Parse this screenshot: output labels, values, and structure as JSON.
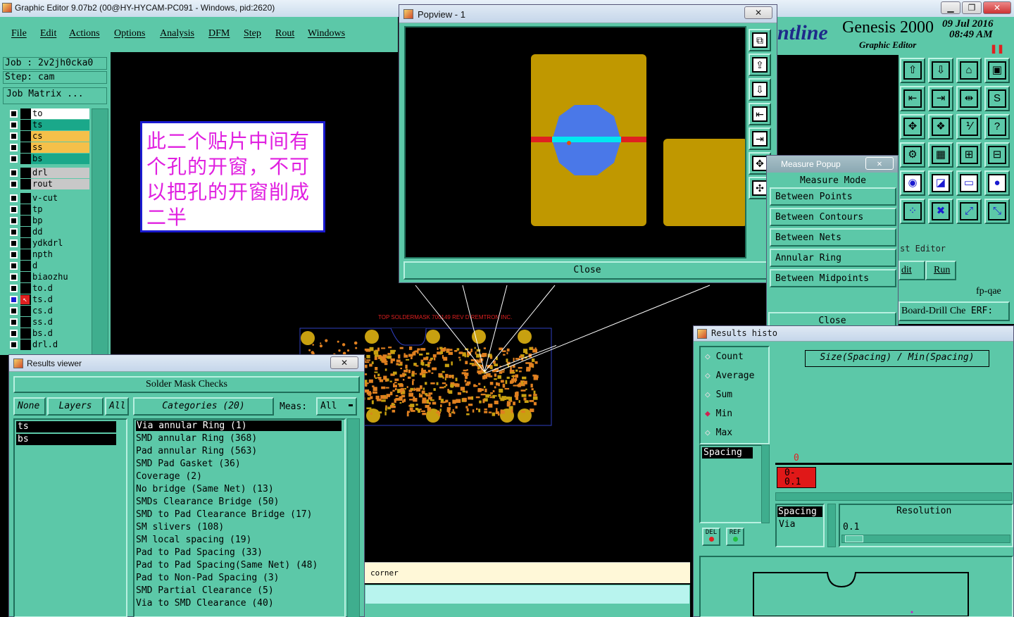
{
  "main_window": {
    "title": "Graphic Editor 9.07b2 (00@HY-HYCAM-PC091 - Windows, pid:2620)",
    "menu": [
      "File",
      "Edit",
      "Actions",
      "Options",
      "Analysis",
      "DFM",
      "Step",
      "Rout",
      "Windows"
    ]
  },
  "brand": {
    "logo_text": "ntline",
    "product": "Genesis 2000",
    "subtitle": "Graphic Editor",
    "date": "09 Jul 2016",
    "time": "08:49 AM"
  },
  "job": {
    "job_label": "Job : 2v2jh0cka0",
    "step_label": "Step: cam",
    "matrix_button": "Job Matrix ..."
  },
  "layers": [
    {
      "name": "to",
      "color": "#ffffff"
    },
    {
      "name": "ts",
      "color": "#1aa88a"
    },
    {
      "name": "cs",
      "color": "#f5c04a"
    },
    {
      "name": "ss",
      "color": "#f5c04a"
    },
    {
      "name": "bs",
      "color": "#1aa88a"
    },
    {
      "name": "drl",
      "color": "#c8c8c8"
    },
    {
      "name": "rout",
      "color": "#c8c8c8"
    },
    {
      "name": "v-cut",
      "color": "#5cc8a8"
    },
    {
      "name": "tp",
      "color": "#5cc8a8"
    },
    {
      "name": "bp",
      "color": "#5cc8a8"
    },
    {
      "name": "dd",
      "color": "#5cc8a8"
    },
    {
      "name": "ydkdrl",
      "color": "#5cc8a8"
    },
    {
      "name": "npth",
      "color": "#5cc8a8"
    },
    {
      "name": "d",
      "color": "#5cc8a8"
    },
    {
      "name": "biaozhu",
      "color": "#5cc8a8"
    },
    {
      "name": "to.d",
      "color": "#5cc8a8"
    },
    {
      "name": "ts.d",
      "color": "#5cc8a8"
    },
    {
      "name": "cs.d",
      "color": "#5cc8a8"
    },
    {
      "name": "ss.d",
      "color": "#5cc8a8"
    },
    {
      "name": "bs.d",
      "color": "#5cc8a8"
    },
    {
      "name": "drl.d",
      "color": "#5cc8a8"
    }
  ],
  "note": {
    "text": "此二个贴片中间有个孔的开窗，不可以把孔的开窗削成二半",
    "color": "#e020e0"
  },
  "board": {
    "label": "TOP SOLDERMASK 700149 REV D  REMTRON INC."
  },
  "popview": {
    "title": "Popview - 1",
    "close": "Close"
  },
  "measure": {
    "title": "Measure Popup",
    "header": "Measure Mode",
    "items": [
      "Between Points",
      "Between Contours",
      "Between Nets",
      "Annular Ring",
      "Between Midpoints"
    ],
    "close": "Close"
  },
  "right_fragments": {
    "editor_label": "st Editor",
    "edit": "dit",
    "run": "Run",
    "fp": "fp-qae",
    "board_drill": "Board-Drill Che",
    "erf": "ERF:"
  },
  "results_viewer": {
    "title": "Results viewer",
    "header": "Solder Mask Checks",
    "btn_none": "None",
    "btn_layers": "Layers",
    "btn_all": "All",
    "categories_label": "Categories (20)",
    "meas_label": "Meas:",
    "meas_value": "All",
    "layers": [
      "ts",
      "bs"
    ],
    "categories": [
      "Via annular Ring (1)",
      "SMD annular Ring (368)",
      "Pad annular Ring (563)",
      "SMD Pad Gasket (36)",
      "Coverage (2)",
      "No bridge (Same Net) (13)",
      "SMDs Clearance Bridge (50)",
      "SMD to Pad Clearance Bridge (17)",
      "SM slivers (108)",
      "SM local spacing (19)",
      "Pad to Pad Spacing (33)",
      "Pad to Pad Spacing(Same Net) (48)",
      "Pad to Non-Pad Spacing (3)",
      "SMD Partial Clearance (5)",
      "Via to SMD Clearance (40)"
    ]
  },
  "status": {
    "corner": "corner"
  },
  "histogram": {
    "title": "Results histo",
    "radios": [
      "Count",
      "Average",
      "Sum",
      "Min",
      "Max"
    ],
    "selected_radio": "Min",
    "list_item": "Spacing",
    "chart_title": "Size(Spacing) / Min(Spacing)",
    "bar_count": "0",
    "bar_label": "0-\n0.1",
    "btn_del": "DEL",
    "btn_ref": "REF",
    "spacing_list": [
      "Spacing",
      "Via"
    ],
    "resolution_label": "Resolution",
    "resolution_value": "0.1"
  }
}
